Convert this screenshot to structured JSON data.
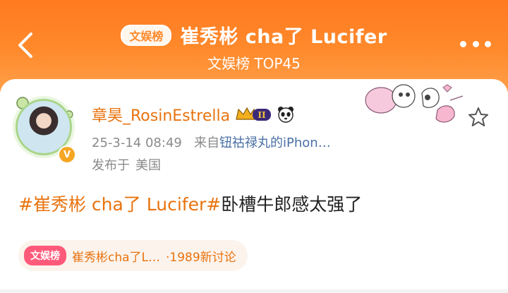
{
  "header": {
    "badge": "文娱榜",
    "title": "崔秀彬 cha了 Lucifer",
    "subtitle": "文娱榜 TOP45"
  },
  "post": {
    "username": "章昊_RosinEstrella",
    "vip_level": "II",
    "timestamp": "25-3-14 08:49",
    "source_prefix": "来自",
    "source": "钮祜禄丸的iPhon…",
    "location_label": "发布于",
    "location": "美国",
    "hashtag": "#崔秀彬 cha了 Lucifer#",
    "body": "卧槽牛郎感太强了"
  },
  "topic": {
    "badge": "文娱榜",
    "text": "崔秀彬cha了L…",
    "count": "·1989新讨论"
  },
  "colors": {
    "header_orange": "#ff7a1f",
    "accent_orange": "#e8730f",
    "topic_badge_pink": "#ff5a7a"
  },
  "icons": [
    "back-icon",
    "more-icon",
    "verified-icon",
    "vip-crown-icon",
    "panda-icon",
    "star-icon",
    "sticker-decoration"
  ]
}
